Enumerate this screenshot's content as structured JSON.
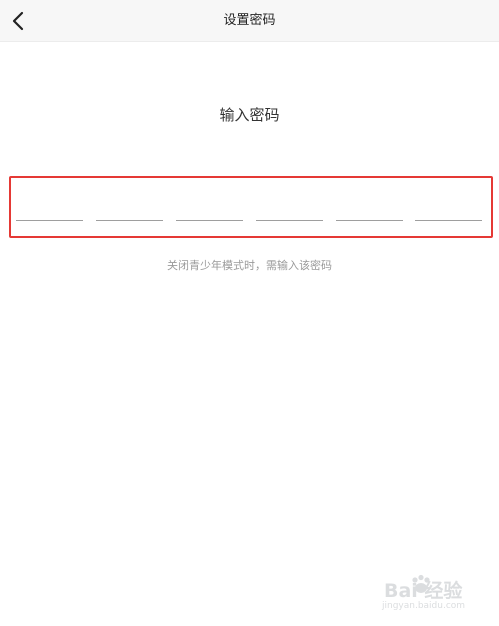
{
  "header": {
    "title": "设置密码",
    "back_icon": "chevron-left-icon"
  },
  "main": {
    "prompt": "输入密码",
    "password_slots": [
      "",
      "",
      "",
      "",
      "",
      ""
    ],
    "hint": "关闭青少年模式时，需输入该密码"
  },
  "watermark": {
    "main": "Bai 经验",
    "sub": "jingyan.baidu.com"
  },
  "colors": {
    "highlight": "#e53935",
    "nav_background": "#f7f7f7",
    "hint_text": "#9a9a9a"
  }
}
